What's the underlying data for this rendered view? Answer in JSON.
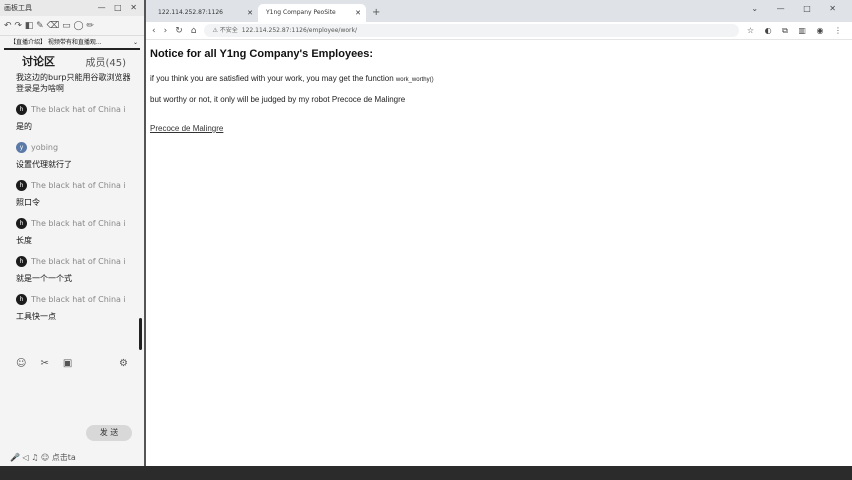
{
  "chat_panel": {
    "window_title": "画板工具",
    "window_controls": "— □ ✕",
    "toolbar_icons": "↶ ↷ ◧ ✎ ⌫ ▭ ◯ ✏",
    "room_tab": "【直播介绍】 视频带有和直播观...",
    "room_caret": "⌄",
    "discussion_title": "讨论区",
    "members_label": "成员(45)",
    "first_message": "我这边的burp只能用谷歌浏览器",
    "first_message_cont": "登录是为啥啊",
    "messages": [
      {
        "author": "The black hat of China i",
        "avatar": "h",
        "text": "是的"
      },
      {
        "author": "yobing",
        "avatar": "y",
        "text": "设置代理就行了"
      },
      {
        "author": "The black hat of China i",
        "avatar": "h",
        "text": "照口令"
      },
      {
        "author": "The black hat of China i",
        "avatar": "h",
        "text": "长度"
      },
      {
        "author": "The black hat of China i",
        "avatar": "h",
        "text": "就是一个一个式"
      },
      {
        "author": "The black hat of China i",
        "avatar": "h",
        "text": "工具快一点"
      }
    ],
    "tool_icons": [
      "☺",
      "✂",
      "▣",
      "⚙"
    ],
    "send_button": "发 送",
    "bottom_icons": "🎤 ◁ ♫ ☺ 点击ta"
  },
  "browser": {
    "tabs": [
      {
        "title": "122.114.252.87:1126",
        "active": false
      },
      {
        "title": "Y1ng Company PeoSite",
        "active": true
      }
    ],
    "new_tab": "+",
    "window_controls": "⌄ — □ ✕",
    "nav": {
      "back": "‹",
      "forward": "›",
      "reload": "↻",
      "home": "⌂"
    },
    "security": "⚠ 不安全",
    "url": "122.114.252.87:1126/employee/work/",
    "ext_icons": "☆ ◐ ⧉ ▥ ◉ ⋮"
  },
  "page": {
    "heading": "Notice for all Y1ng Company's Employees:",
    "line1_prefix": "if you think you are satisfied with your work, you may get the function ",
    "line1_function": "work_worthy()",
    "line2": "but worthy or not, it only will be judged by my robot Precoce de Malingre",
    "link": "Precoce de Malingre"
  }
}
